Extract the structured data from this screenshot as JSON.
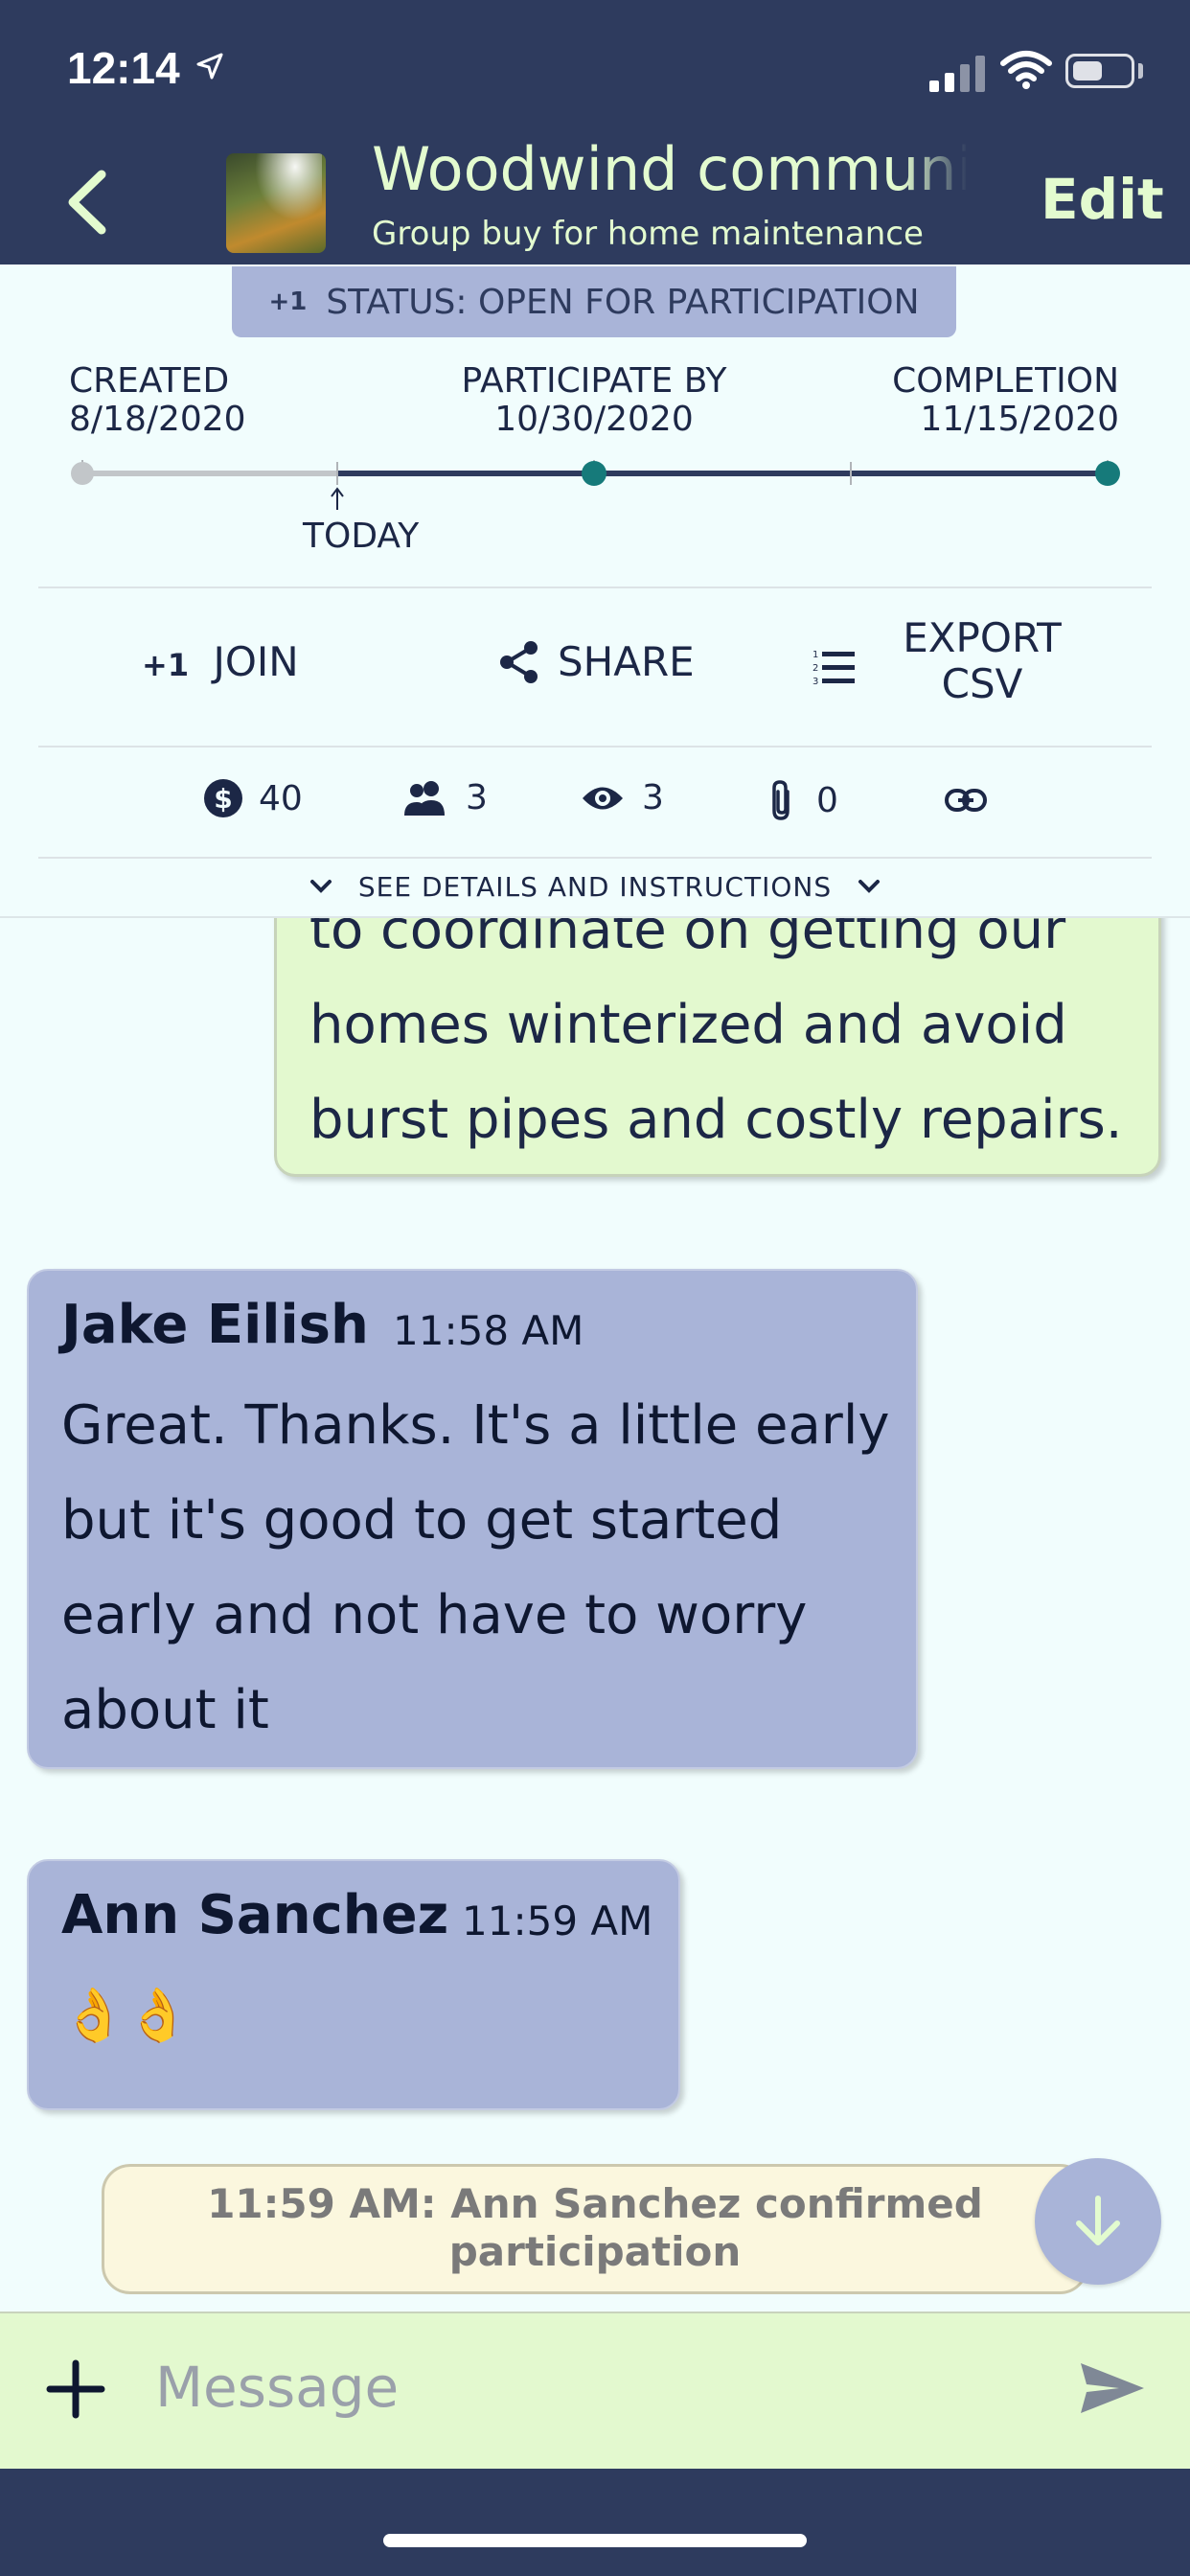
{
  "status_bar": {
    "time": "12:14"
  },
  "header": {
    "title": "Woodwind communit",
    "subtitle": "Group buy for home maintenance",
    "edit_label": "Edit"
  },
  "status_badge": {
    "prefix": "+1",
    "text": "STATUS: OPEN FOR PARTICIPATION"
  },
  "timeline": {
    "created_label": "CREATED",
    "created_date": "8/18/2020",
    "participate_label": "PARTICIPATE BY",
    "participate_date": "10/30/2020",
    "completion_label": "COMPLETION",
    "completion_date": "11/15/2020",
    "today_label": "TODAY"
  },
  "actions": {
    "join_prefix": "+1",
    "join_label": "JOIN",
    "share_label": "SHARE",
    "export_line1": "EXPORT",
    "export_line2": "CSV"
  },
  "stats": {
    "amount": "40",
    "participants": "3",
    "views": "3",
    "attachments": "0"
  },
  "details_toggle": "SEE DETAILS AND INSTRUCTIONS",
  "messages": {
    "own_partial": [
      "to coordinate on getting our",
      "homes winterized and avoid",
      "burst pipes and costly repairs."
    ],
    "jake": {
      "name": "Jake Eilish",
      "time": "11:58 AM",
      "lines": [
        "Great. Thanks. It's a little early",
        "but it's good to get started",
        "early and not have to worry",
        "about it"
      ]
    },
    "ann": {
      "name": "Ann Sanchez",
      "time": "11:59 AM",
      "text": "👌👌"
    }
  },
  "system_message": {
    "line1": "11:59 AM: Ann Sanchez confirmed",
    "line2": "participation"
  },
  "composer": {
    "placeholder": "Message"
  },
  "colors": {
    "header_bg": "#2e3b5e",
    "accent_green": "#e3fbcf",
    "timeline_active": "#2e3b5e",
    "timeline_dot": "#167a7a",
    "bubble_blue": "#a9b4d8",
    "bubble_green": "#e3f9cf"
  }
}
